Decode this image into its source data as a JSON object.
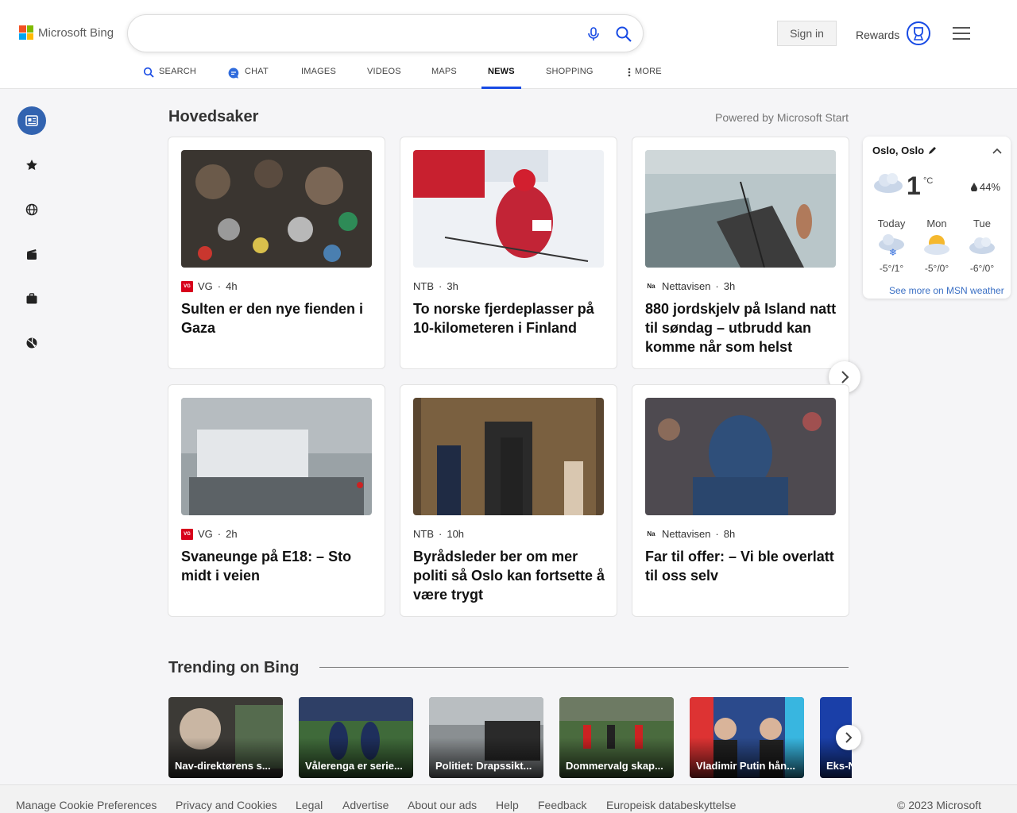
{
  "brand": {
    "name": "Microsoft Bing"
  },
  "search": {
    "value": "",
    "placeholder": ""
  },
  "header": {
    "sign_in": "Sign in",
    "rewards": "Rewards"
  },
  "nav": {
    "tabs": [
      {
        "label": "SEARCH"
      },
      {
        "label": "CHAT"
      },
      {
        "label": "IMAGES"
      },
      {
        "label": "VIDEOS"
      },
      {
        "label": "MAPS"
      },
      {
        "label": "NEWS",
        "active": true
      },
      {
        "label": "SHOPPING"
      },
      {
        "label": "MORE"
      }
    ]
  },
  "rail": {
    "icons": [
      "news-icon",
      "star-icon",
      "globe-icon",
      "clapperboard-icon",
      "briefcase-icon",
      "sports-icon"
    ]
  },
  "main": {
    "title": "Hovedsaker",
    "powered_by": "Powered by Microsoft Start",
    "articles": [
      {
        "source": "VG",
        "age": "4h",
        "title": "Sulten er den nye fienden i Gaza"
      },
      {
        "source": "NTB",
        "age": "3h",
        "title": "To norske fjerdeplasser på 10-kilometeren i Finland"
      },
      {
        "source": "Nettavisen",
        "age": "3h",
        "title": "880 jordskjelv på Island natt til søndag – utbrudd kan komme når som helst"
      },
      {
        "source": "VG",
        "age": "2h",
        "title": "Svaneunge på E18: – Sto midt i veien"
      },
      {
        "source": "NTB",
        "age": "10h",
        "title": "Byrådsleder ber om mer politi så Oslo kan fortsette å være trygt"
      },
      {
        "source": "Nettavisen",
        "age": "8h",
        "title": "Far til offer: – Vi ble overlatt til oss selv"
      }
    ]
  },
  "weather": {
    "location": "Oslo, Oslo",
    "temp": "1",
    "unit": "°C",
    "humidity": "44%",
    "forecast": [
      {
        "day": "Today",
        "range": "-5°/1°",
        "icon": "snow-cloud-icon"
      },
      {
        "day": "Mon",
        "range": "-5°/0°",
        "icon": "partly-sunny-icon"
      },
      {
        "day": "Tue",
        "range": "-6°/0°",
        "icon": "cloud-icon"
      }
    ],
    "more_link": "See more on MSN weather"
  },
  "trending": {
    "title": "Trending on Bing",
    "items": [
      {
        "label": "Nav-direktørens s..."
      },
      {
        "label": "Vålerenga er serie..."
      },
      {
        "label": "Politiet: Drapssikt..."
      },
      {
        "label": "Dommervalg skap..."
      },
      {
        "label": "Vladimir Putin hån..."
      },
      {
        "label": "Eks-N"
      }
    ]
  },
  "footer": {
    "links": [
      "Manage Cookie Preferences",
      "Privacy and Cookies",
      "Legal",
      "Advertise",
      "About our ads",
      "Help",
      "Feedback",
      "Europeisk databeskyttelse"
    ],
    "copyright": "© 2023 Microsoft"
  },
  "colors": {
    "accent": "#174ae4",
    "weather_link": "#3a6fc4",
    "vg_red": "#d7001b"
  }
}
